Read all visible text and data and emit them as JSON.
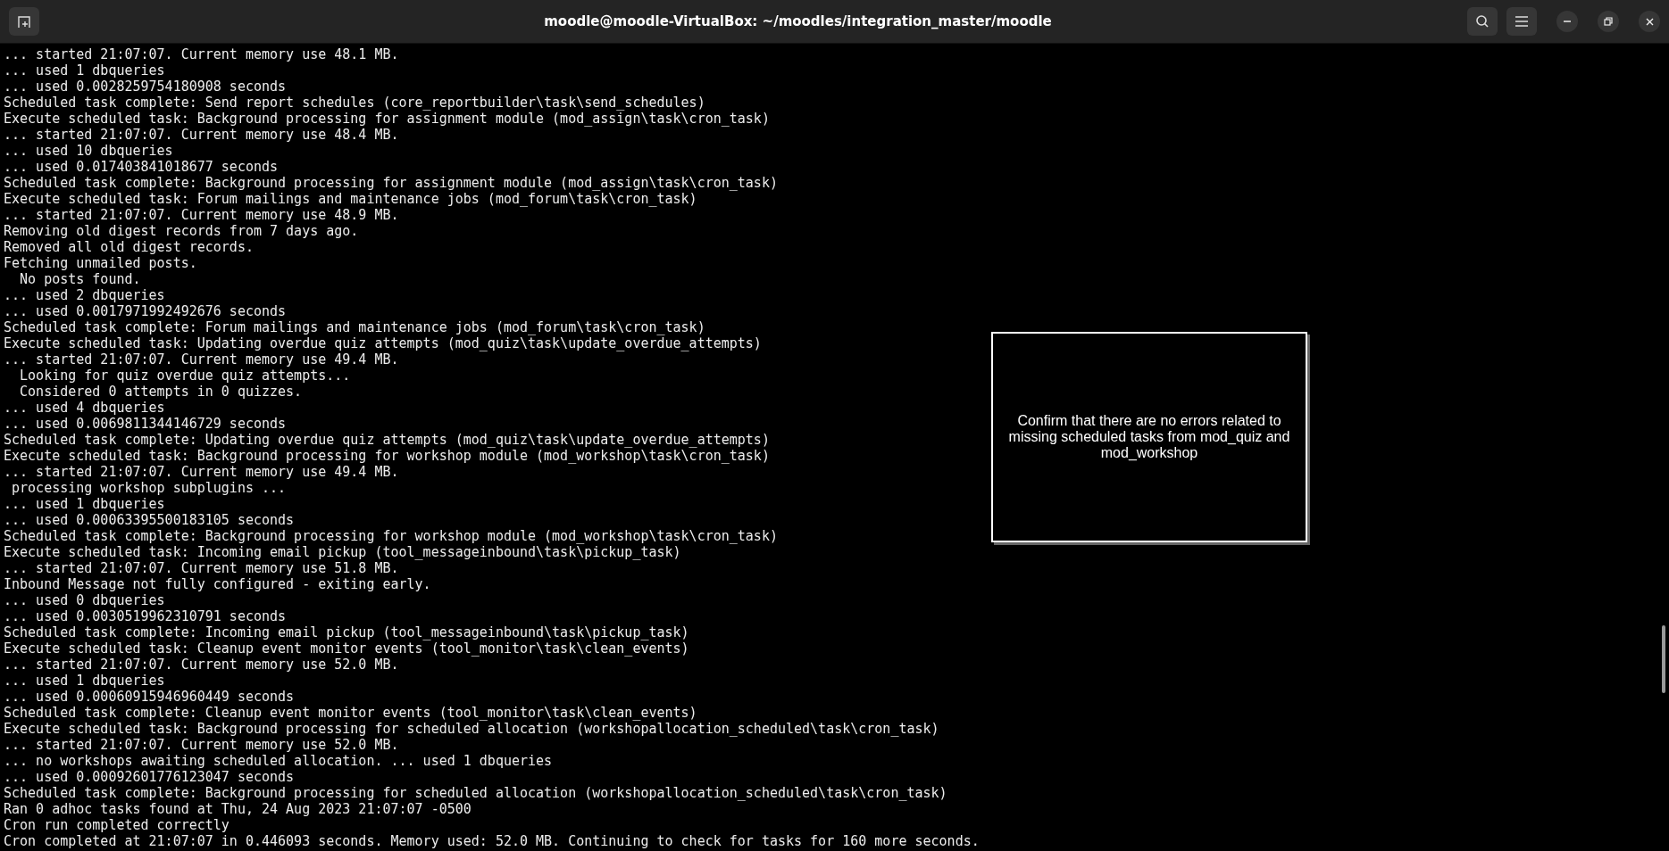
{
  "window": {
    "title": "moodle@moodle-VirtualBox: ~/moodles/integration_master/moodle"
  },
  "terminal": {
    "lines": [
      "... started 21:07:07. Current memory use 48.1 MB.",
      "... used 1 dbqueries",
      "... used 0.0028259754180908 seconds",
      "Scheduled task complete: Send report schedules (core_reportbuilder\\task\\send_schedules)",
      "Execute scheduled task: Background processing for assignment module (mod_assign\\task\\cron_task)",
      "... started 21:07:07. Current memory use 48.4 MB.",
      "... used 10 dbqueries",
      "... used 0.017403841018677 seconds",
      "Scheduled task complete: Background processing for assignment module (mod_assign\\task\\cron_task)",
      "Execute scheduled task: Forum mailings and maintenance jobs (mod_forum\\task\\cron_task)",
      "... started 21:07:07. Current memory use 48.9 MB.",
      "Removing old digest records from 7 days ago.",
      "Removed all old digest records.",
      "Fetching unmailed posts.",
      "  No posts found.",
      "... used 2 dbqueries",
      "... used 0.0017971992492676 seconds",
      "Scheduled task complete: Forum mailings and maintenance jobs (mod_forum\\task\\cron_task)",
      "Execute scheduled task: Updating overdue quiz attempts (mod_quiz\\task\\update_overdue_attempts)",
      "... started 21:07:07. Current memory use 49.4 MB.",
      "  Looking for quiz overdue quiz attempts...",
      "  Considered 0 attempts in 0 quizzes.",
      "... used 4 dbqueries",
      "... used 0.0069811344146729 seconds",
      "Scheduled task complete: Updating overdue quiz attempts (mod_quiz\\task\\update_overdue_attempts)",
      "Execute scheduled task: Background processing for workshop module (mod_workshop\\task\\cron_task)",
      "... started 21:07:07. Current memory use 49.4 MB.",
      " processing workshop subplugins ...",
      "... used 1 dbqueries",
      "... used 0.00063395500183105 seconds",
      "Scheduled task complete: Background processing for workshop module (mod_workshop\\task\\cron_task)",
      "Execute scheduled task: Incoming email pickup (tool_messageinbound\\task\\pickup_task)",
      "... started 21:07:07. Current memory use 51.8 MB.",
      "Inbound Message not fully configured - exiting early.",
      "... used 0 dbqueries",
      "... used 0.0030519962310791 seconds",
      "Scheduled task complete: Incoming email pickup (tool_messageinbound\\task\\pickup_task)",
      "Execute scheduled task: Cleanup event monitor events (tool_monitor\\task\\clean_events)",
      "... started 21:07:07. Current memory use 52.0 MB.",
      "... used 1 dbqueries",
      "... used 0.00060915946960449 seconds",
      "Scheduled task complete: Cleanup event monitor events (tool_monitor\\task\\clean_events)",
      "Execute scheduled task: Background processing for scheduled allocation (workshopallocation_scheduled\\task\\cron_task)",
      "... started 21:07:07. Current memory use 52.0 MB.",
      "... no workshops awaiting scheduled allocation. ... used 1 dbqueries",
      "... used 0.00092601776123047 seconds",
      "Scheduled task complete: Background processing for scheduled allocation (workshopallocation_scheduled\\task\\cron_task)",
      "Ran 0 adhoc tasks found at Thu, 24 Aug 2023 21:07:07 -0500",
      "Cron run completed correctly",
      "Cron completed at 21:07:07 in 0.446093 seconds. Memory used: 52.0 MB. Continuing to check for tasks for 160 more seconds."
    ]
  },
  "overlay": {
    "text": "Confirm that there are no errors related to missing scheduled tasks from mod_quiz and mod_workshop"
  }
}
